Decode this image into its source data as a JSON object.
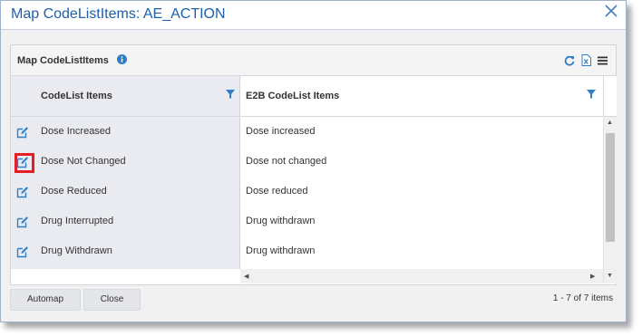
{
  "dialog": {
    "title": "Map CodeListItems: AE_ACTION",
    "close_icon": "close-icon"
  },
  "panel": {
    "title": "Map CodeListItems",
    "toolbar_icons": [
      "info-icon",
      "refresh-icon",
      "excel-export-icon",
      "menu-icon"
    ]
  },
  "grid": {
    "columns": [
      "CodeList Items",
      "E2B CodeList Items"
    ],
    "rows": [
      {
        "item": "Dose Increased",
        "e2b": "Dose increased"
      },
      {
        "item": "Dose Not Changed",
        "e2b": "Dose not changed"
      },
      {
        "item": "Dose Reduced",
        "e2b": "Dose reduced"
      },
      {
        "item": "Drug Interrupted",
        "e2b": "Drug withdrawn"
      },
      {
        "item": "Drug Withdrawn",
        "e2b": "Drug withdrawn"
      }
    ]
  },
  "footer": {
    "automap_label": "Automap",
    "close_label": "Close",
    "count_text": "1 - 7 of 7 items"
  },
  "colors": {
    "accent": "#1d5fa8",
    "icon_blue": "#2f7fc8",
    "highlight": "#e31e24"
  }
}
